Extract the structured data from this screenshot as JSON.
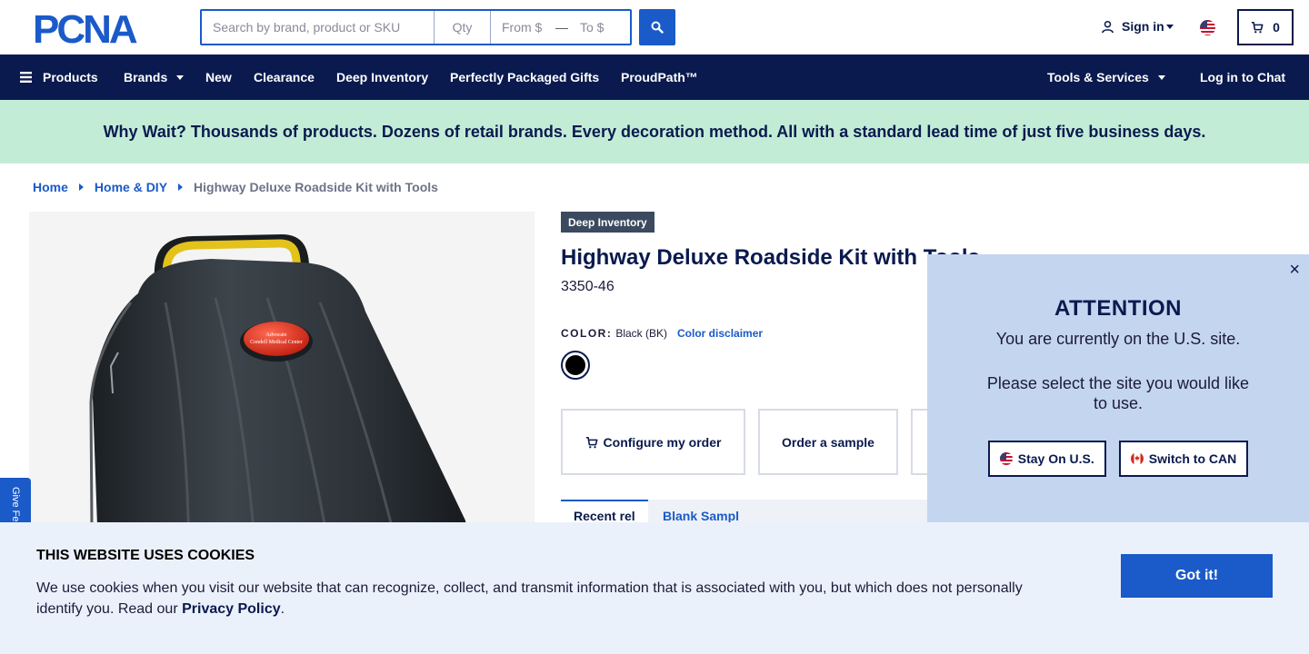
{
  "header": {
    "logo_text": "PCNA",
    "search_placeholder": "Search by brand, product or SKU",
    "qty_placeholder": "Qty",
    "from_placeholder": "From $",
    "dash": "—",
    "to_placeholder": "To $",
    "signin_label": "Sign in",
    "cart_count": "0"
  },
  "nav": {
    "products": "Products",
    "brands": "Brands",
    "new": "New",
    "clearance": "Clearance",
    "deep_inventory": "Deep Inventory",
    "gifts": "Perfectly Packaged Gifts",
    "proudpath": "ProudPath™",
    "tools": "Tools & Services",
    "chat": "Log in to Chat"
  },
  "banner": {
    "text": "Why Wait? Thousands of products. Dozens of retail brands. Every decoration method. All with a standard lead time of just five business days."
  },
  "breadcrumb": {
    "home": "Home",
    "category": "Home & DIY",
    "current": "Highway Deluxe Roadside Kit with Tools"
  },
  "product": {
    "badge": "Deep Inventory",
    "title": "Highway Deluxe Roadside Kit with Tools",
    "sku": "3350-46",
    "color_label": "COLOR:",
    "color_value": "Black (BK)",
    "color_disclaimer": "Color disclaimer",
    "swatch_color": "#000000",
    "image_label": "Advocate Condell Medical Center"
  },
  "actions": {
    "configure": "Configure my order",
    "sample": "Order a sample"
  },
  "tabs": {
    "active": "Recent rel",
    "inactive": "Blank  Sampl"
  },
  "feedback": {
    "label": "Give Feedback"
  },
  "attention": {
    "close": "×",
    "title": "ATTENTION",
    "line1": "You are currently on the U.S. site.",
    "line2": "Please select the site you would like to use.",
    "stay": "Stay On U.S.",
    "switch": "Switch to CAN"
  },
  "cookie": {
    "title": "THIS WEBSITE USES COOKIES",
    "text": "We use cookies when you visit our website that can recognize, collect, and transmit information that is associated with you, but which does not personally identify you. Read our ",
    "link": "Privacy Policy",
    "period": ".",
    "button": "Got it!"
  },
  "colors": {
    "navy": "#0a1a4e",
    "blue": "#1a5ac9",
    "banner_green": "#c3ecd6",
    "attention_bg": "#c4d5f0",
    "cookie_bg": "#ebf1fb"
  }
}
